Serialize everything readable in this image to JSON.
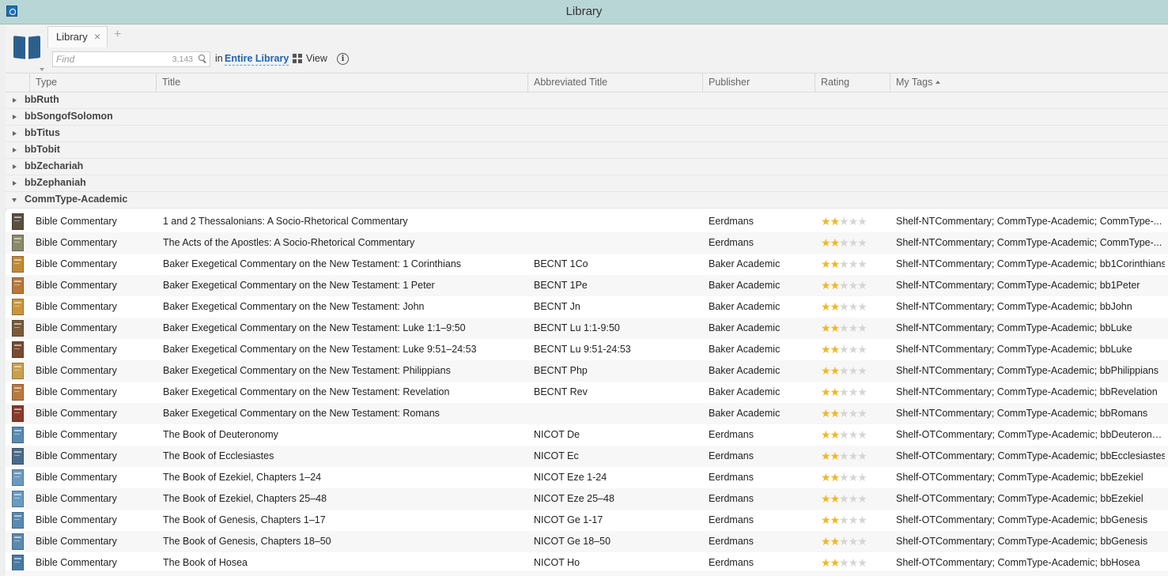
{
  "window": {
    "title": "Library"
  },
  "tabs": [
    {
      "label": "Library",
      "close": "×"
    }
  ],
  "new_tab": "+",
  "search": {
    "placeholder": "Find",
    "count": "3,143",
    "in_label": "in",
    "scope": "Entire Library"
  },
  "toolbar": {
    "view_label": "View",
    "info_glyph": "i"
  },
  "columns": [
    "Type",
    "Title",
    "Abbreviated Title",
    "Publisher",
    "Rating",
    "My Tags"
  ],
  "sort": {
    "column": "My Tags",
    "direction": "ascending"
  },
  "groups_collapsed": [
    "bbRuth",
    "bbSongofSolomon",
    "bbTitus",
    "bbTobit",
    "bbZechariah",
    "bbZephaniah"
  ],
  "group_expanded": "CommType-Academic",
  "colors": {
    "titlebar": "#b9d6d6",
    "link": "#1d64b0",
    "star": "#f2b71f"
  },
  "rows": [
    {
      "type": "Bible Commentary",
      "title": "1 and 2 Thessalonians: A Socio-Rhetorical Commentary",
      "abbr": "",
      "publisher": "Eerdmans",
      "rating": 2,
      "tags": "Shelf-NTCommentary; CommType-Academic; CommType-...",
      "cover": "#5a5040"
    },
    {
      "type": "Bible Commentary",
      "title": "The Acts of the Apostles: A Socio-Rhetorical Commentary",
      "abbr": "",
      "publisher": "Eerdmans",
      "rating": 2,
      "tags": "Shelf-NTCommentary; CommType-Academic; CommType-...",
      "cover": "#8a8a6a"
    },
    {
      "type": "Bible Commentary",
      "title": "Baker Exegetical Commentary on the New Testament: 1 Corinthians",
      "abbr": "BECNT 1Co",
      "publisher": "Baker Academic",
      "rating": 2,
      "tags": "Shelf-NTCommentary; CommType-Academic; bb1Corinthians",
      "cover": "#c08a3a"
    },
    {
      "type": "Bible Commentary",
      "title": "Baker Exegetical Commentary on the New Testament: 1 Peter",
      "abbr": "BECNT 1Pe",
      "publisher": "Baker Academic",
      "rating": 2,
      "tags": "Shelf-NTCommentary; CommType-Academic; bb1Peter",
      "cover": "#b8783a"
    },
    {
      "type": "Bible Commentary",
      "title": "Baker Exegetical Commentary on the New Testament: John",
      "abbr": "BECNT Jn",
      "publisher": "Baker Academic",
      "rating": 2,
      "tags": "Shelf-NTCommentary; CommType-Academic; bbJohn",
      "cover": "#c9953f"
    },
    {
      "type": "Bible Commentary",
      "title": "Baker Exegetical Commentary on the New Testament: Luke 1:1–9:50",
      "abbr": "BECNT Lu 1:1-9:50",
      "publisher": "Baker Academic",
      "rating": 2,
      "tags": "Shelf-NTCommentary; CommType-Academic; bbLuke",
      "cover": "#7a5a3a"
    },
    {
      "type": "Bible Commentary",
      "title": "Baker Exegetical Commentary on the New Testament: Luke 9:51–24:53",
      "abbr": "BECNT Lu 9:51-24:53",
      "publisher": "Baker Academic",
      "rating": 2,
      "tags": "Shelf-NTCommentary; CommType-Academic; bbLuke",
      "cover": "#7a4a30"
    },
    {
      "type": "Bible Commentary",
      "title": "Baker Exegetical Commentary on the New Testament: Philippians",
      "abbr": "BECNT Php",
      "publisher": "Baker Academic",
      "rating": 2,
      "tags": "Shelf-NTCommentary; CommType-Academic; bbPhilippians",
      "cover": "#c8a050"
    },
    {
      "type": "Bible Commentary",
      "title": "Baker Exegetical Commentary on the New Testament: Revelation",
      "abbr": "BECNT Rev",
      "publisher": "Baker Academic",
      "rating": 2,
      "tags": "Shelf-NTCommentary; CommType-Academic; bbRevelation",
      "cover": "#b87a40"
    },
    {
      "type": "Bible Commentary",
      "title": "Baker Exegetical Commentary on the New Testament: Romans",
      "abbr": "",
      "publisher": "Baker Academic",
      "rating": 2,
      "tags": "Shelf-NTCommentary; CommType-Academic; bbRomans",
      "cover": "#8a3a28"
    },
    {
      "type": "Bible Commentary",
      "title": "The Book of Deuteronomy",
      "abbr": "NICOT De",
      "publisher": "Eerdmans",
      "rating": 2,
      "tags": "Shelf-OTCommentary; CommType-Academic; bbDeuteron…",
      "cover": "#5a8ab0"
    },
    {
      "type": "Bible Commentary",
      "title": "The Book of Ecclesiastes",
      "abbr": "NICOT Ec",
      "publisher": "Eerdmans",
      "rating": 2,
      "tags": "Shelf-OTCommentary; CommType-Academic; bbEcclesiastes",
      "cover": "#4a6a8a"
    },
    {
      "type": "Bible Commentary",
      "title": "The Book of Ezekiel, Chapters 1–24",
      "abbr": "NICOT Eze 1-24",
      "publisher": "Eerdmans",
      "rating": 2,
      "tags": "Shelf-OTCommentary; CommType-Academic; bbEzekiel",
      "cover": "#6a9ac0"
    },
    {
      "type": "Bible Commentary",
      "title": "The Book of Ezekiel, Chapters 25–48",
      "abbr": "NICOT Eze 25–48",
      "publisher": "Eerdmans",
      "rating": 2,
      "tags": "Shelf-OTCommentary; CommType-Academic; bbEzekiel",
      "cover": "#6a9ac0"
    },
    {
      "type": "Bible Commentary",
      "title": "The Book of Genesis, Chapters 1–17",
      "abbr": "NICOT Ge 1-17",
      "publisher": "Eerdmans",
      "rating": 2,
      "tags": "Shelf-OTCommentary; CommType-Academic; bbGenesis",
      "cover": "#5a8ab0"
    },
    {
      "type": "Bible Commentary",
      "title": "The Book of Genesis, Chapters 18–50",
      "abbr": "NICOT Ge 18–50",
      "publisher": "Eerdmans",
      "rating": 2,
      "tags": "Shelf-OTCommentary; CommType-Academic; bbGenesis",
      "cover": "#5a8ab0"
    },
    {
      "type": "Bible Commentary",
      "title": "The Book of Hosea",
      "abbr": "NICOT Ho",
      "publisher": "Eerdmans",
      "rating": 2,
      "tags": "Shelf-OTCommentary; CommType-Academic; bbHosea",
      "cover": "#4a7aa0"
    }
  ]
}
